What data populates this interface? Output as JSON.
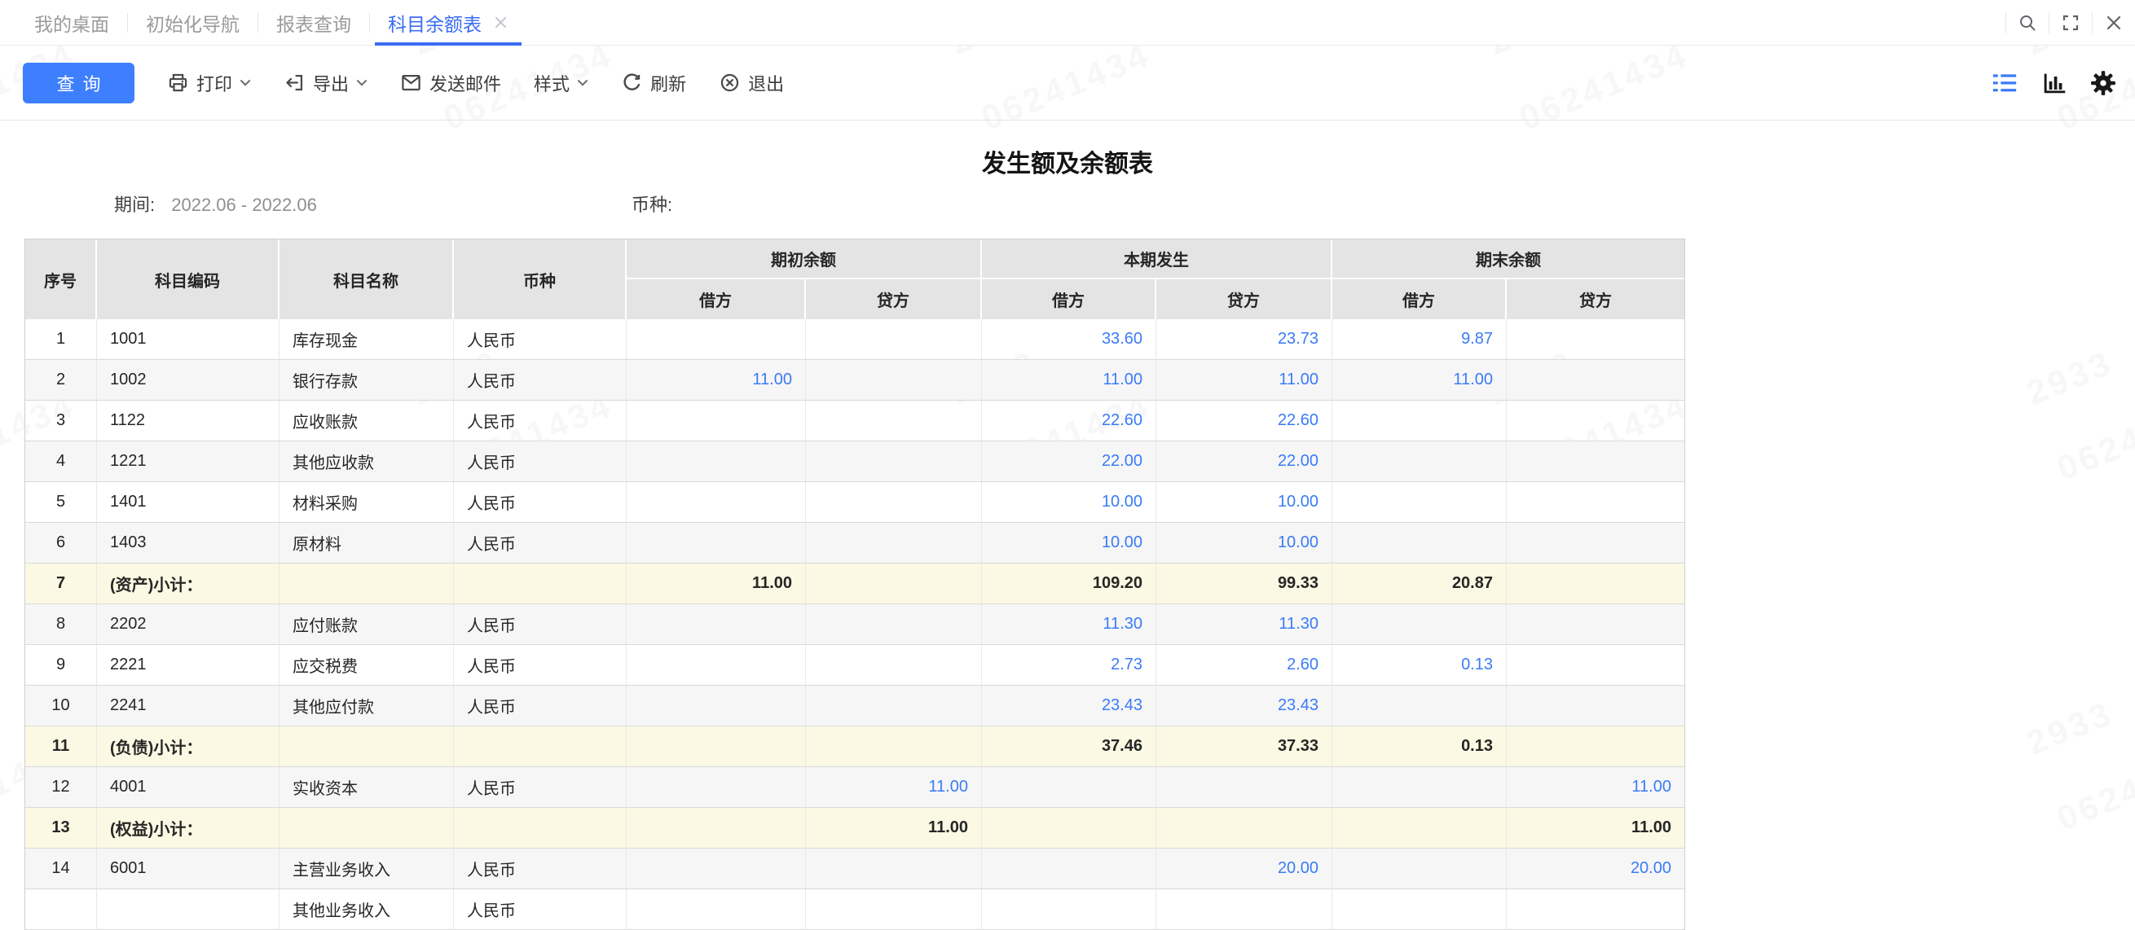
{
  "colors": {
    "accent_button": "#3d7fff",
    "tab_active": "#3a6cf3",
    "value_link": "#3a7bf8",
    "subtotal_bg": "#fbf9e3",
    "zebra_bg": "#f6f6f6",
    "header_bg": "#e4e4e4"
  },
  "tabbar": {
    "tabs": [
      {
        "label": "我的桌面",
        "active": false
      },
      {
        "label": "初始化导航",
        "active": false
      },
      {
        "label": "报表查询",
        "active": false
      },
      {
        "label": "科目余额表",
        "active": true,
        "closable": true
      }
    ],
    "window_icons": [
      "search",
      "fullscreen",
      "close"
    ]
  },
  "toolbar": {
    "query_label": "查询",
    "items": [
      {
        "label": "打印",
        "icon": "printer",
        "caret": true
      },
      {
        "label": "导出",
        "icon": "export",
        "caret": true
      },
      {
        "label": "发送邮件",
        "icon": "mail",
        "caret": false
      },
      {
        "label": "样式",
        "icon": null,
        "caret": true
      },
      {
        "label": "刷新",
        "icon": "refresh",
        "caret": false
      },
      {
        "label": "退出",
        "icon": "exit-circle",
        "caret": false
      }
    ],
    "view_icons": [
      "list-view",
      "bar-chart",
      "gear"
    ]
  },
  "report": {
    "title": "发生额及余额表",
    "period_label": "期间:",
    "period_value": "2022.06 - 2022.06",
    "currency_label": "币种:",
    "currency_value": ""
  },
  "table": {
    "columns": {
      "seq": "序号",
      "code": "科目编码",
      "name": "科目名称",
      "currency": "币种"
    },
    "groups": [
      {
        "label": "期初余额"
      },
      {
        "label": "本期发生"
      },
      {
        "label": "期末余额"
      }
    ],
    "sub": {
      "debit": "借方",
      "credit": "贷方"
    },
    "rows": [
      {
        "type": "normal",
        "seq": "1",
        "code": "1001",
        "name": "库存现金",
        "currency": "人民币",
        "open_debit": "",
        "open_credit": "",
        "period_debit": "33.60",
        "period_credit": "23.73",
        "end_debit": "9.87",
        "end_credit": ""
      },
      {
        "type": "normal",
        "seq": "2",
        "code": "1002",
        "name": "银行存款",
        "currency": "人民币",
        "open_debit": "11.00",
        "open_credit": "",
        "period_debit": "11.00",
        "period_credit": "11.00",
        "end_debit": "11.00",
        "end_credit": ""
      },
      {
        "type": "normal",
        "seq": "3",
        "code": "1122",
        "name": "应收账款",
        "currency": "人民币",
        "open_debit": "",
        "open_credit": "",
        "period_debit": "22.60",
        "period_credit": "22.60",
        "end_debit": "",
        "end_credit": ""
      },
      {
        "type": "normal",
        "seq": "4",
        "code": "1221",
        "name": "其他应收款",
        "currency": "人民币",
        "open_debit": "",
        "open_credit": "",
        "period_debit": "22.00",
        "period_credit": "22.00",
        "end_debit": "",
        "end_credit": ""
      },
      {
        "type": "normal",
        "seq": "5",
        "code": "1401",
        "name": "材料采购",
        "currency": "人民币",
        "open_debit": "",
        "open_credit": "",
        "period_debit": "10.00",
        "period_credit": "10.00",
        "end_debit": "",
        "end_credit": ""
      },
      {
        "type": "normal",
        "seq": "6",
        "code": "1403",
        "name": "原材料",
        "currency": "人民币",
        "open_debit": "",
        "open_credit": "",
        "period_debit": "10.00",
        "period_credit": "10.00",
        "end_debit": "",
        "end_credit": ""
      },
      {
        "type": "subtotal",
        "seq": "7",
        "code": "(资产)小计：",
        "name": "",
        "currency": "",
        "open_debit": "11.00",
        "open_credit": "",
        "period_debit": "109.20",
        "period_credit": "99.33",
        "end_debit": "20.87",
        "end_credit": ""
      },
      {
        "type": "normal",
        "seq": "8",
        "code": "2202",
        "name": "应付账款",
        "currency": "人民币",
        "open_debit": "",
        "open_credit": "",
        "period_debit": "11.30",
        "period_credit": "11.30",
        "end_debit": "",
        "end_credit": ""
      },
      {
        "type": "normal",
        "seq": "9",
        "code": "2221",
        "name": "应交税费",
        "currency": "人民币",
        "open_debit": "",
        "open_credit": "",
        "period_debit": "2.73",
        "period_credit": "2.60",
        "end_debit": "0.13",
        "end_credit": ""
      },
      {
        "type": "normal",
        "seq": "10",
        "code": "2241",
        "name": "其他应付款",
        "currency": "人民币",
        "open_debit": "",
        "open_credit": "",
        "period_debit": "23.43",
        "period_credit": "23.43",
        "end_debit": "",
        "end_credit": ""
      },
      {
        "type": "subtotal",
        "seq": "11",
        "code": "(负债)小计：",
        "name": "",
        "currency": "",
        "open_debit": "",
        "open_credit": "",
        "period_debit": "37.46",
        "period_credit": "37.33",
        "end_debit": "0.13",
        "end_credit": ""
      },
      {
        "type": "normal",
        "seq": "12",
        "code": "4001",
        "name": "实收资本",
        "currency": "人民币",
        "open_debit": "",
        "open_credit": "11.00",
        "period_debit": "",
        "period_credit": "",
        "end_debit": "",
        "end_credit": "11.00"
      },
      {
        "type": "subtotal",
        "seq": "13",
        "code": "(权益)小计：",
        "name": "",
        "currency": "",
        "open_debit": "",
        "open_credit": "11.00",
        "period_debit": "",
        "period_credit": "",
        "end_debit": "",
        "end_credit": "11.00"
      },
      {
        "type": "normal",
        "seq": "14",
        "code": "6001",
        "name": "主营业务收入",
        "currency": "人民币",
        "open_debit": "",
        "open_credit": "",
        "period_debit": "",
        "period_credit": "20.00",
        "end_debit": "",
        "end_credit": "20.00"
      },
      {
        "type": "normal",
        "seq": "",
        "code": "",
        "name": "其他业务收入",
        "currency": "人民币",
        "open_debit": "",
        "open_credit": "",
        "period_debit": "",
        "period_credit": "",
        "end_debit": "",
        "end_credit": ""
      }
    ]
  },
  "watermark": {
    "lines": [
      "2933",
      "06241434"
    ]
  }
}
